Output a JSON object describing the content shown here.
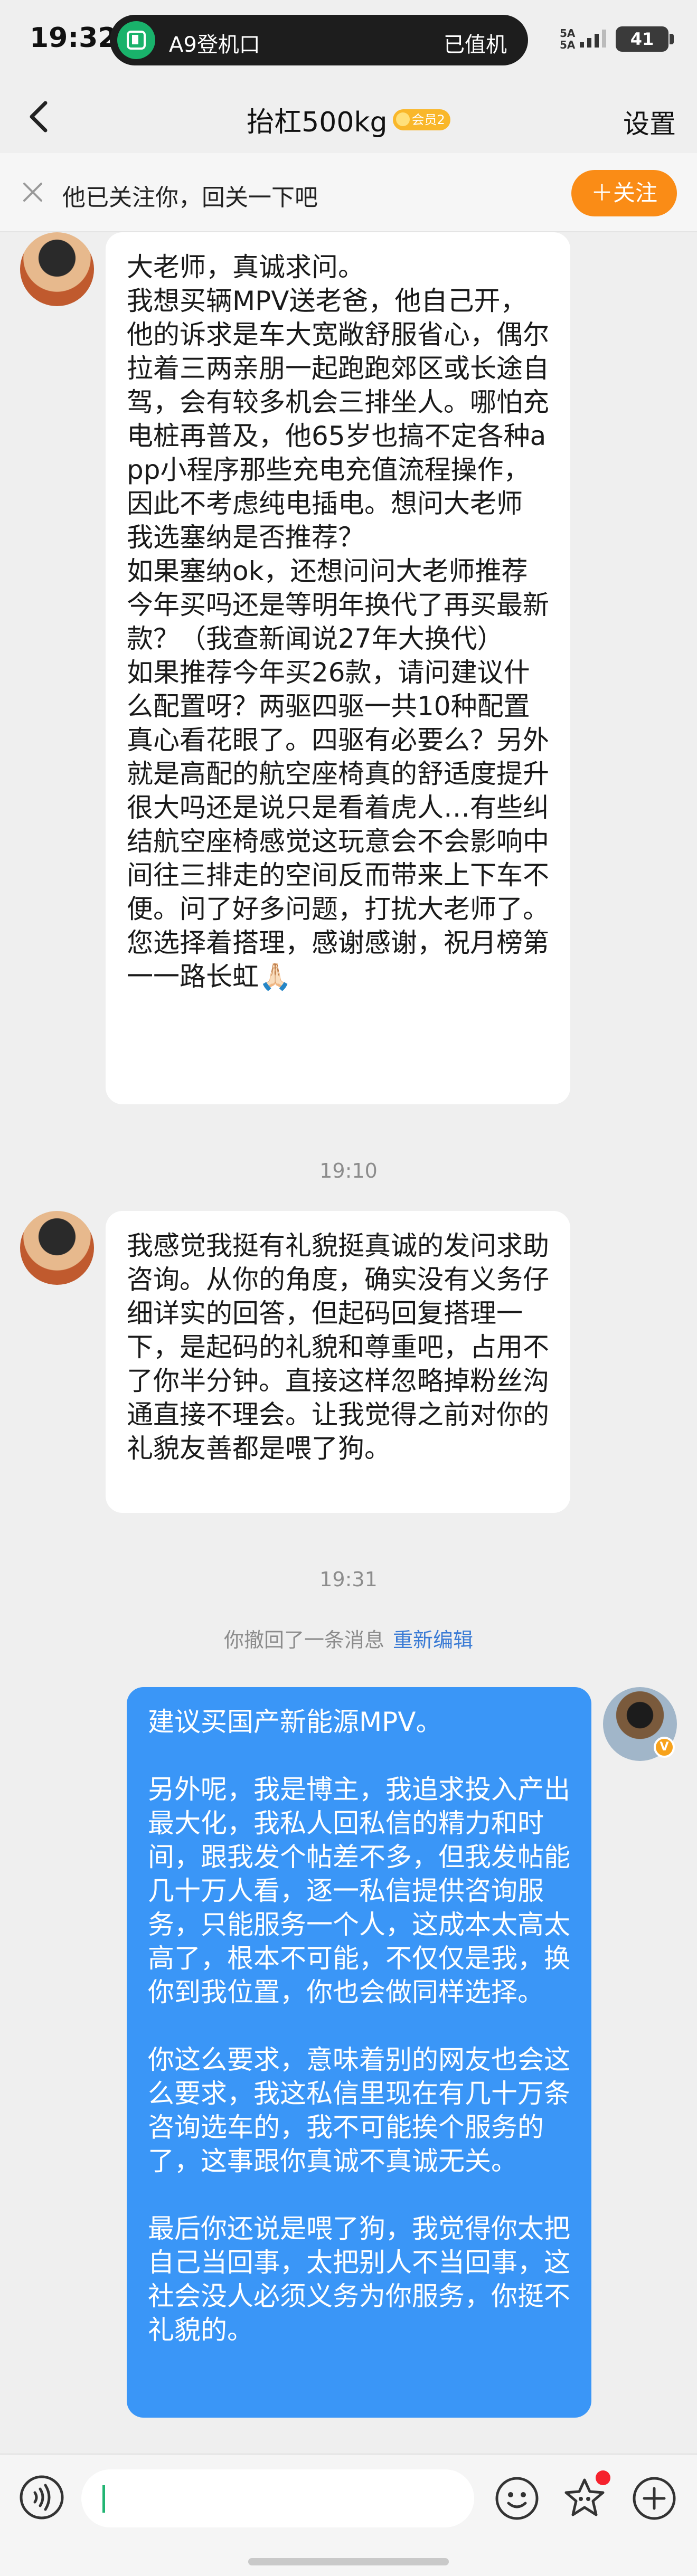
{
  "status_bar": {
    "time": "19:32",
    "app_text": "A9登机口",
    "app_status": "已值机",
    "signal_text": "5A\n5A",
    "battery": "41"
  },
  "header": {
    "title": "抬杠500kg",
    "badge": "会员2",
    "settings": "设置"
  },
  "follow_notice": {
    "text": "他已关注你，回关一下吧",
    "button": "＋关注"
  },
  "messages": [
    {
      "text": "大老师，真诚求问。\n我想买辆MPV送老爸，他自己开，他的诉求是车大宽敞舒服省心，偶尔拉着三两亲朋一起跑跑郊区或长途自驾，会有较多机会三排坐人。哪怕充电桩再普及，他65岁也搞不定各种app小程序那些充电充值流程操作，因此不考虑纯电插电。想问大老师 我选塞纳是否推荐？\n如果塞纳ok，还想问问大老师推荐今年买吗还是等明年换代了再买最新款？（我查新闻说27年大换代）\n如果推荐今年买26款，请问建议什么配置呀？两驱四驱一共10种配置真心看花眼了。四驱有必要么？另外就是高配的航空座椅真的舒适度提升很大吗还是说只是看着虎人…有些纠结航空座椅感觉这玩意会不会影响中间往三排走的空间反而带来上下车不便。问了好多问题，打扰大老师了。您选择着搭理，感谢感谢，祝月榜第一一路长虹🙏🏻"
    },
    {
      "text": "我感觉我挺有礼貌挺真诚的发问求助咨询。从你的角度，确实没有义务仔细详实的回答，但起码回复搭理一下，是起码的礼貌和尊重吧，占用不了你半分钟。直接这样忽略掉粉丝沟通直接不理会。让我觉得之前对你的礼貌友善都是喂了狗。"
    },
    {
      "text": "建议买国产新能源MPV。\n\n另外呢，我是博主，我追求投入产出最大化，我私人回私信的精力和时间，跟我发个帖差不多，但我发帖能几十万人看，逐一私信提供咨询服务，只能服务一个人，这成本太高太高了，根本不可能，不仅仅是我，换你到我位置，你也会做同样选择。\n\n你这么要求，意味着别的网友也会这么要求，我这私信里现在有几十万条咨询选车的，我不可能挨个服务的了，这事跟你真诚不真诚无关。\n\n最后你还说是喂了狗，我觉得你太把自己当回事，太把别人不当回事，这社会没人必须义务为你服务，你挺不礼貌的。"
    }
  ],
  "timestamps": [
    "19:10",
    "19:31"
  ],
  "recall": {
    "text": "你撤回了一条消息",
    "link": "重新编辑"
  },
  "verified_badge": "V"
}
